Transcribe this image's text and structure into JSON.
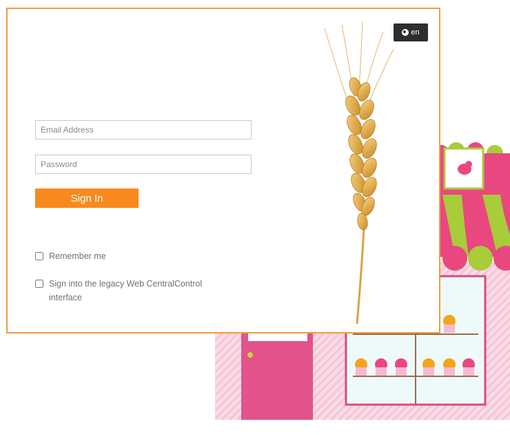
{
  "language": {
    "label": "en",
    "icon": "globe-icon"
  },
  "form": {
    "email_placeholder": "Email Address",
    "password_placeholder": "Password",
    "signin_label": "Sign In",
    "remember_label": "Remember me",
    "legacy_label": "Sign into the legacy Web CentralControl interface"
  },
  "colors": {
    "accent": "#f7891e",
    "dialog_border": "#f49a3c",
    "language_button": "#2e2e2e",
    "awning_pink": "#e8487f",
    "awning_green": "#a8cc3a"
  }
}
